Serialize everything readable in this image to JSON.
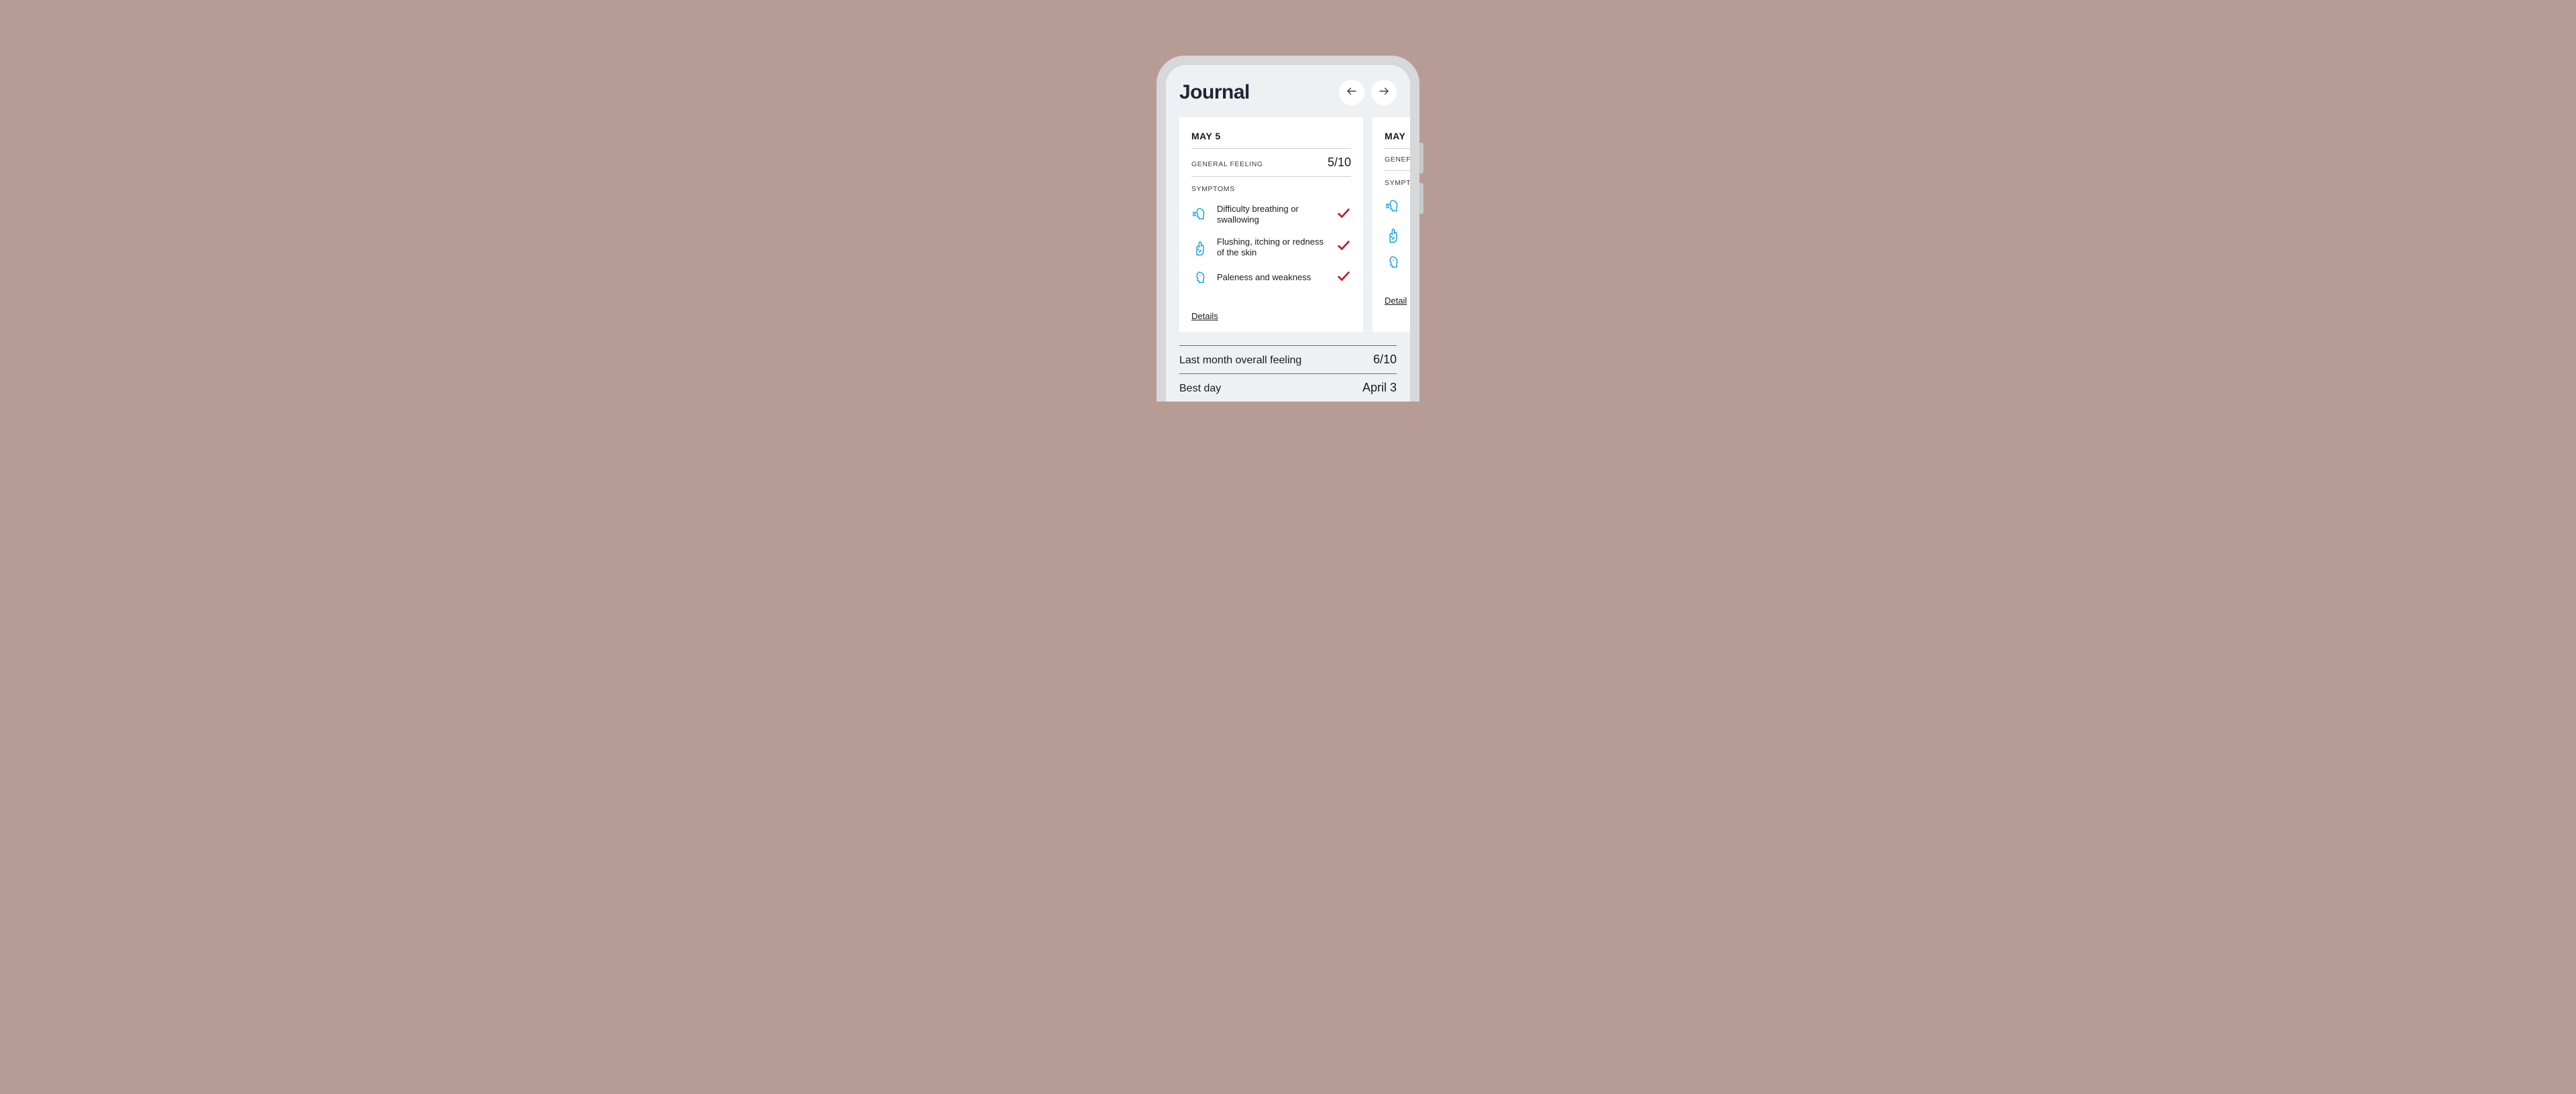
{
  "header": {
    "title": "Journal"
  },
  "cards": [
    {
      "date": "MAY 5",
      "feeling_label": "GENERAL FEELING",
      "feeling_score": "5/10",
      "symptoms_label": "SYMPTOMS",
      "symptoms": [
        {
          "text": "Difficulty breathing or swallowing",
          "icon": "head-breath-icon"
        },
        {
          "text": "Flushing, itching or redness of the skin",
          "icon": "hand-icon"
        },
        {
          "text": "Paleness and weakness",
          "icon": "pale-head-icon"
        }
      ],
      "details_label": "Details"
    },
    {
      "date": "MAY",
      "feeling_label": "GENEF",
      "symptoms_label": "SYMPT",
      "details_label": "Detail"
    }
  ],
  "summary": [
    {
      "label": "Last month overall feeling",
      "value": "6/10"
    },
    {
      "label": "Best day",
      "value": "April 3"
    }
  ],
  "icons": {
    "arrow_left": "arrow-left-icon",
    "arrow_right": "arrow-right-icon",
    "check": "check-icon"
  },
  "colors": {
    "accent_blue": "#159fe0",
    "check_red": "#ba1e23"
  }
}
